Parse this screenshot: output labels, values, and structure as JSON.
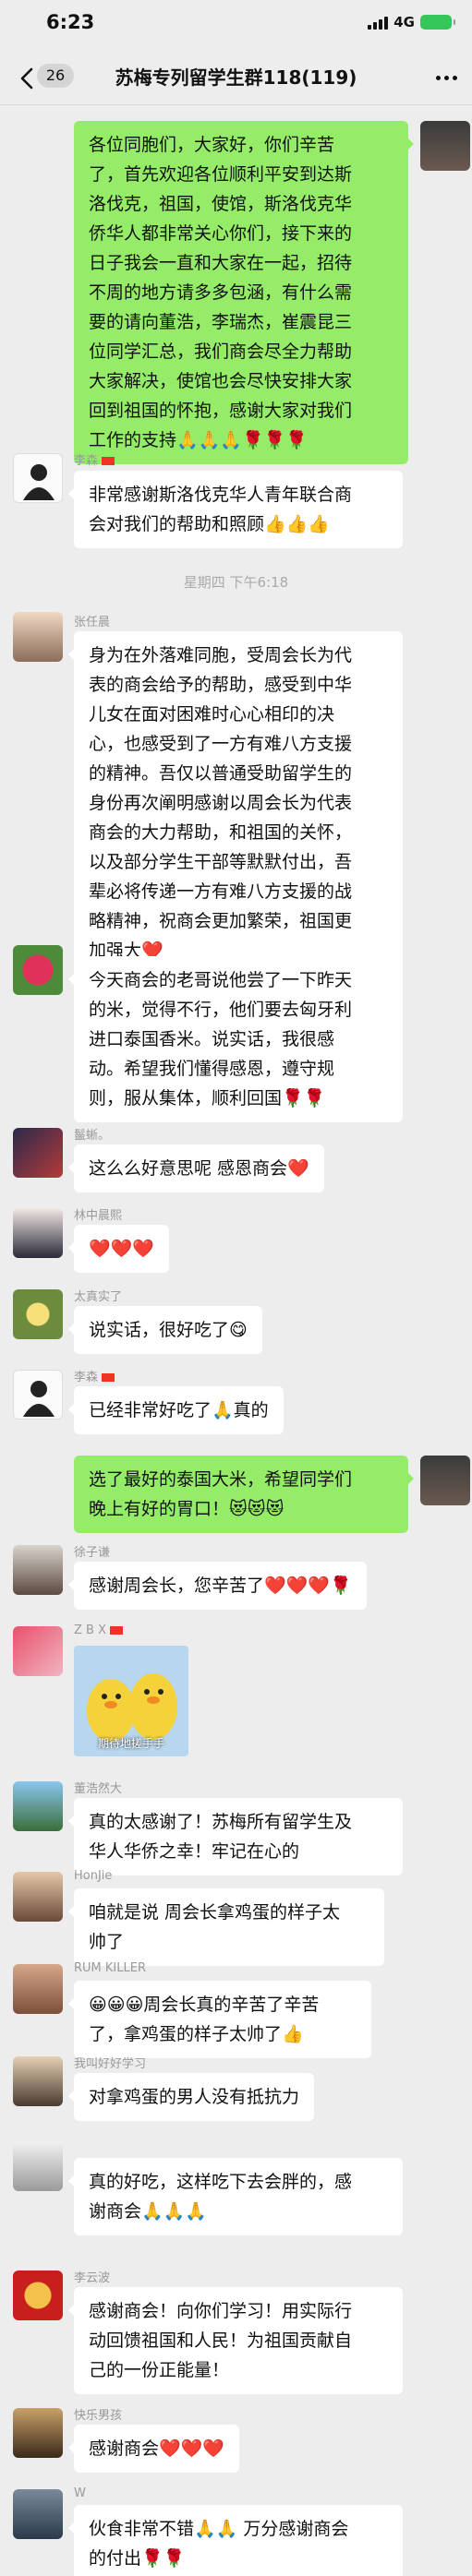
{
  "status_bar": {
    "time": "6:23",
    "network": "4G",
    "battery": ""
  },
  "nav": {
    "unread_count": "26",
    "title": "苏梅专列留学生群118(119)"
  },
  "time_divider": "星期四 下午6:18",
  "messages": [
    {
      "sender": "",
      "lines": [
        "各位同胞们，大家好，你们辛苦",
        "了，首先欢迎各位顺利平安到达斯",
        "洛伐克，祖国，使馆，斯洛伐克华",
        "侨华人都非常关心你们，接下来的",
        "日子我会一直和大家在一起，招待",
        "不周的地方请多多包涵，有什么需",
        "要的请向董浩，李瑞杰，崔震昆三",
        "位同学汇总，我们商会尽全力帮助",
        "大家解决，使馆也会尽快安排大家",
        "回到祖国的怀抱，感谢大家对我们",
        "工作的支持🙏🙏🙏🌹🌹🌹"
      ]
    },
    {
      "sender": "李森",
      "lines": [
        "非常感谢斯洛伐克华人青年联合商",
        "会对我们的帮助和照顾👍👍👍"
      ]
    },
    {
      "sender": "张任晨",
      "lines": [
        "身为在外落难同胞，受周会长为代",
        "表的商会给予的帮助，感受到中华",
        "儿女在面对困难时心心相印的决",
        "心，也感受到了一方有难八方支援",
        "的精神。吾仅以普通受助留学生的",
        "身份再次阐明感谢以周会长为代表",
        "商会的大力帮助，和祖国的关怀，",
        "以及部分学生干部等默默付出，吾",
        "辈必将传递一方有难八方支援的战",
        "略精神，祝商会更加繁荣，祖国更",
        "加强大❤️"
      ]
    },
    {
      "sender": "",
      "lines": [
        "今天商会的老哥说他尝了一下昨天",
        "的米，觉得不行，他们要去匈牙利",
        "进口泰国香米。说实话，我很感",
        "动。希望我们懂得感恩，遵守规",
        "则，服从集体，顺利回国🌹🌹"
      ]
    },
    {
      "sender": "鬣蜥。",
      "lines": [
        "这么么好意思呢  感恩商会❤️"
      ]
    },
    {
      "sender": "林中晨熙",
      "lines": [
        "❤️❤️❤️"
      ]
    },
    {
      "sender": "太真实了",
      "lines": [
        "说实话，很好吃了😋"
      ]
    },
    {
      "sender": "李森",
      "lines": [
        "已经非常好吃了🙏真的"
      ]
    },
    {
      "sender": "",
      "lines": [
        "选了最好的泰国大米，希望同学们",
        "晚上有好的胃口！😻😻😻"
      ]
    },
    {
      "sender": "徐子谦",
      "lines": [
        "感谢周会长，您辛苦了❤️❤️❤️🌹"
      ]
    },
    {
      "sender": "Z B X",
      "sticker_caption": "期待地搓手手"
    },
    {
      "sender": "董浩然大",
      "lines": [
        "真的太感谢了！苏梅所有留学生及",
        "华人华侨之幸！牢记在心的"
      ]
    },
    {
      "sender": "HonJie",
      "lines": [
        "咱就是说 周会长拿鸡蛋的样子太",
        "帅了"
      ]
    },
    {
      "sender": "RUM KILLER",
      "lines": [
        "😀😀😀周会长真的辛苦了辛苦",
        "了，拿鸡蛋的样子太帅了👍"
      ]
    },
    {
      "sender": "我叫好好学习",
      "lines": [
        "对拿鸡蛋的男人没有抵抗力"
      ]
    },
    {
      "sender": "",
      "lines": [
        "真的好吃，这样吃下去会胖的，感",
        "谢商会🙏🙏🙏"
      ]
    },
    {
      "sender": "李云波",
      "lines": [
        "感谢商会！向你们学习！用实际行",
        "动回馈祖国和人民！为祖国贡献自",
        "己的一份正能量！"
      ]
    },
    {
      "sender": "快乐男孩",
      "lines": [
        "感谢商会❤️❤️❤️"
      ]
    },
    {
      "sender": "W",
      "lines": [
        "伙食非常不错🙏🙏 万分感谢商会",
        "的付出🌹🌹"
      ]
    }
  ],
  "colors": {
    "background": "#ededed",
    "own_bubble": "#95ec69",
    "other_bubble": "#ffffff"
  },
  "icons": [
    "back-chevron-icon",
    "more-dots-icon",
    "signal-icon",
    "battery-icon"
  ]
}
